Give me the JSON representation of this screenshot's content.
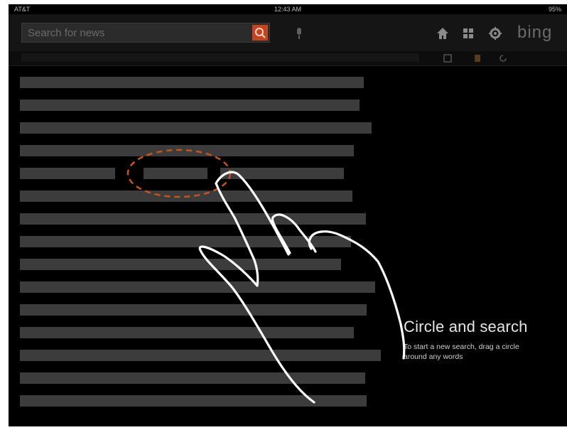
{
  "status": {
    "carrier": "AT&T",
    "time": "12:43 AM",
    "battery": "95%"
  },
  "toolbar": {
    "search_placeholder": "Search for news",
    "logo_text": "bing",
    "accent": "#c4441f",
    "icons": [
      "search-icon",
      "mic-icon",
      "home-icon",
      "grid-icon",
      "gear-icon"
    ]
  },
  "tutorial": {
    "title": "Circle and search",
    "body": "To start a new search, drag a circle around any words",
    "circle_color": "#c4551f",
    "hand_stroke": "#ffffff"
  }
}
